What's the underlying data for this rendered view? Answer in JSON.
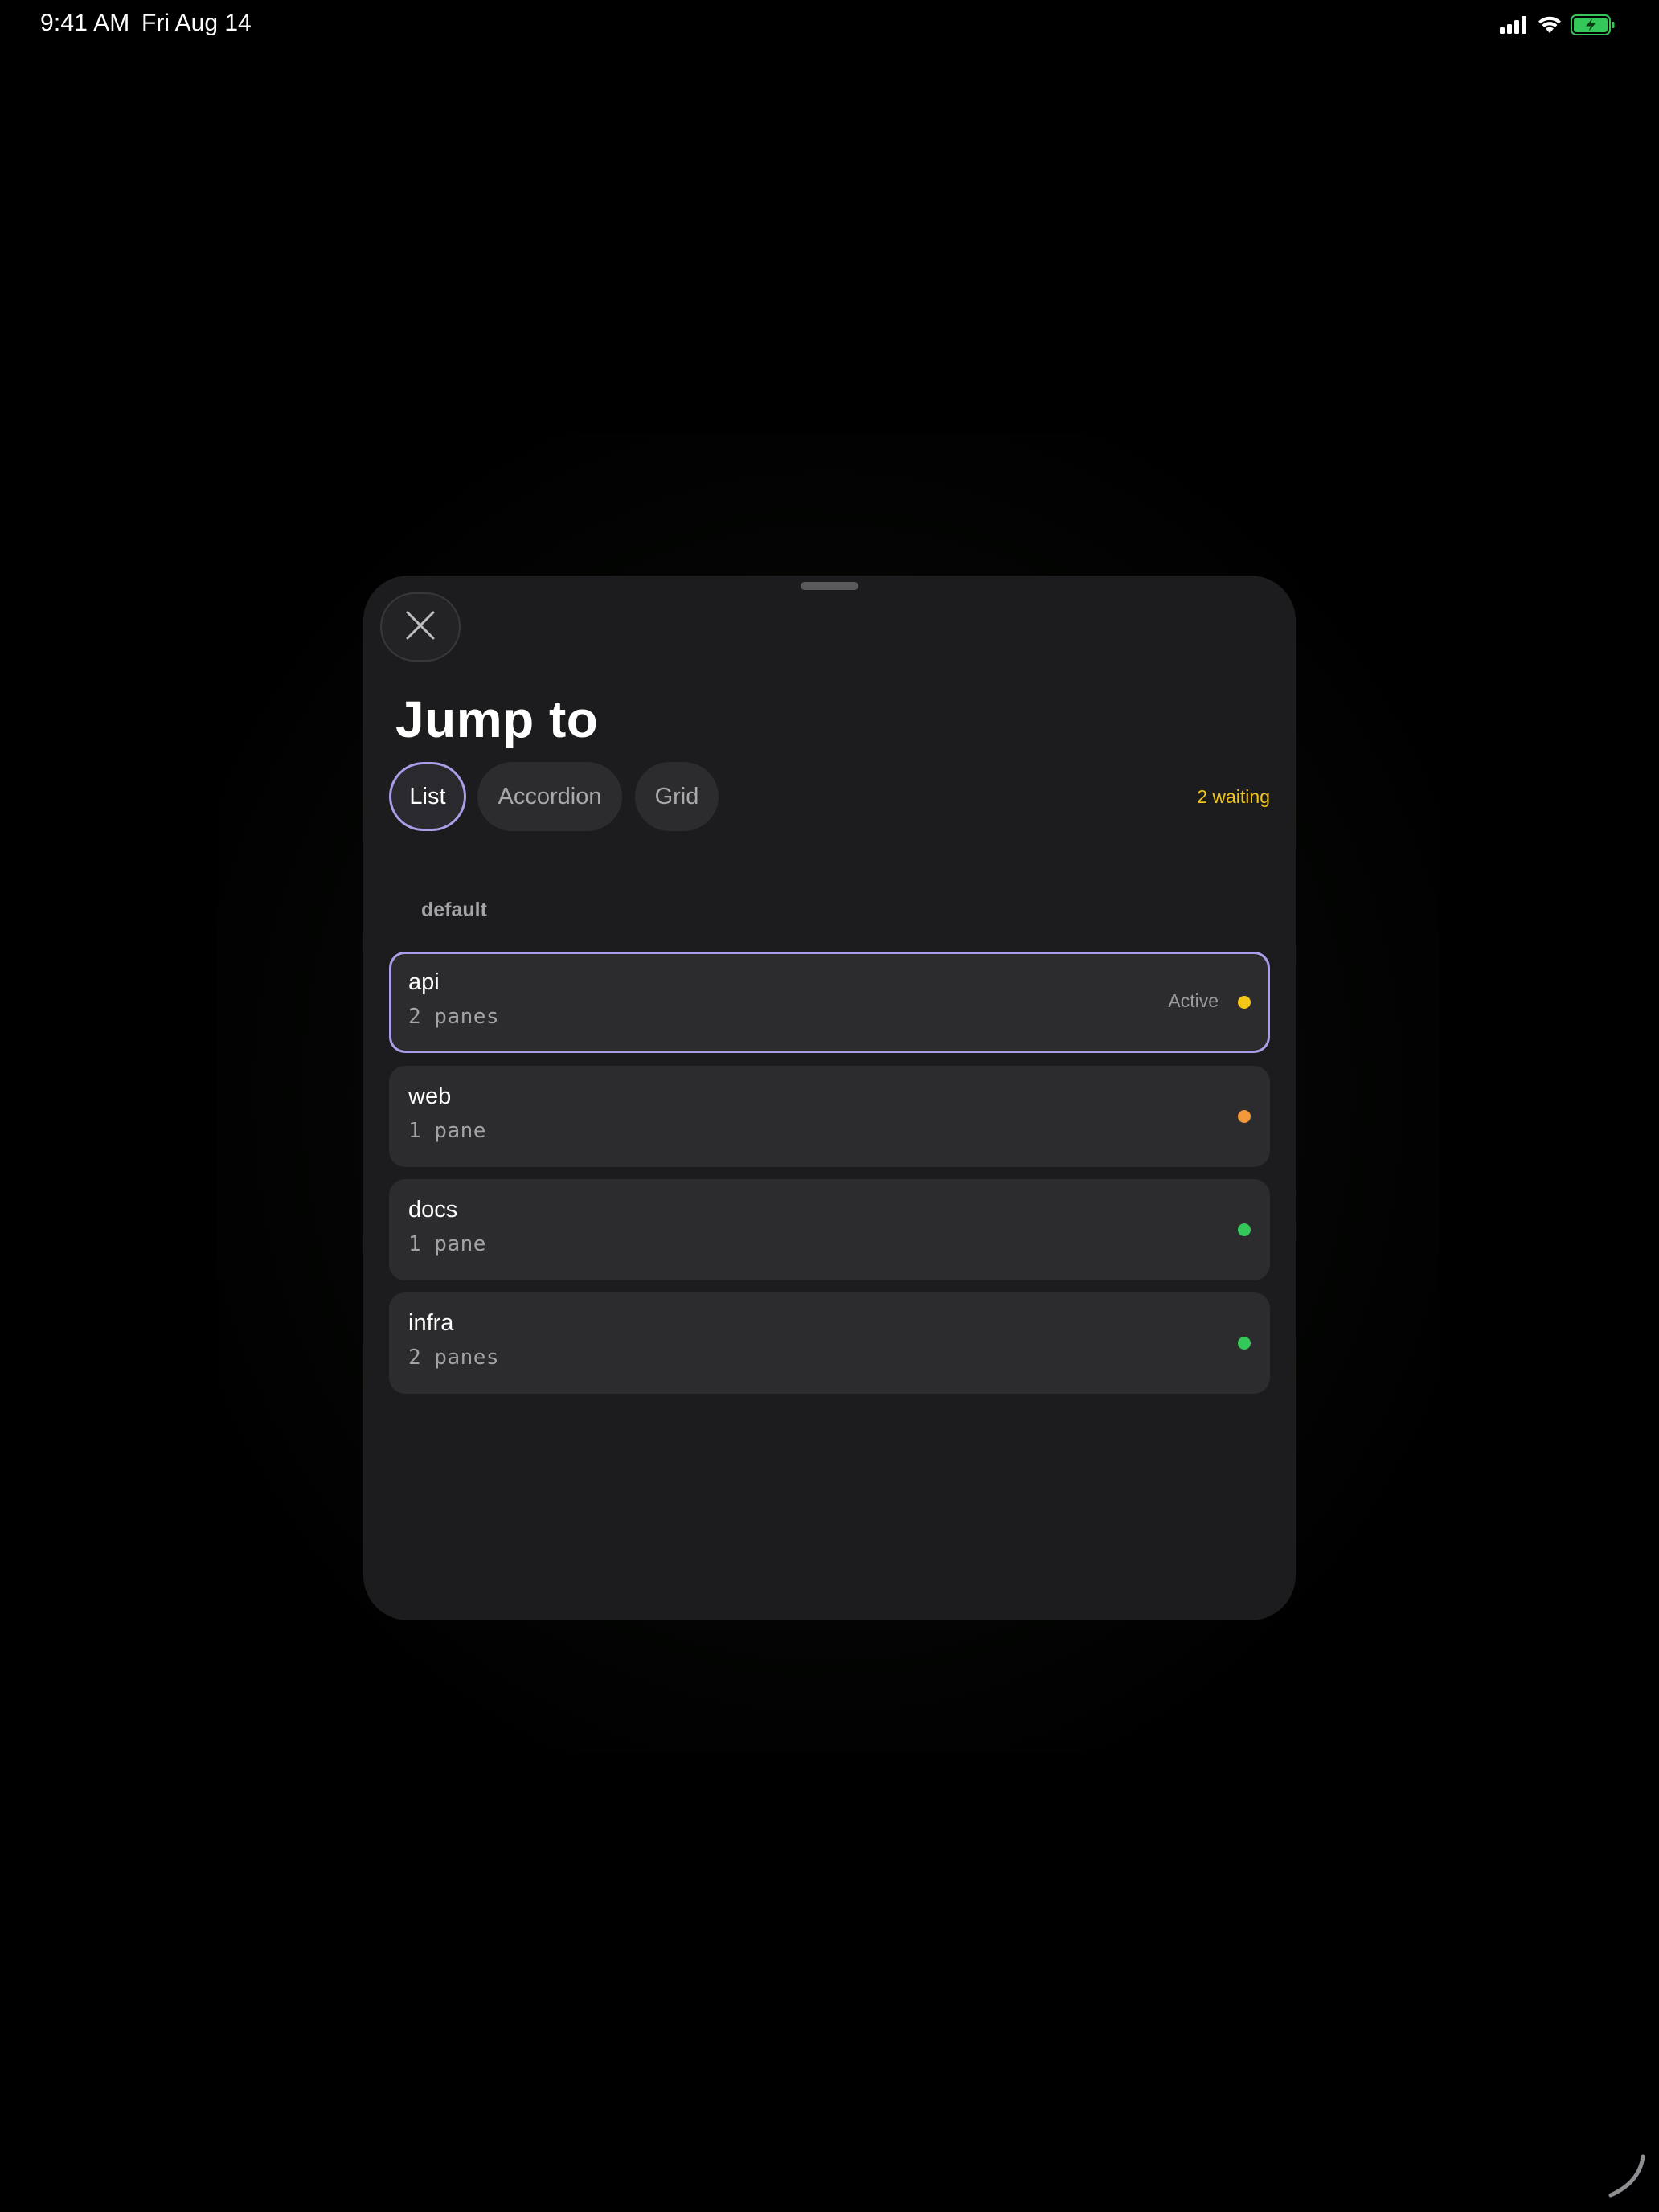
{
  "status_bar": {
    "time": "9:41 AM",
    "date": "Fri Aug 14",
    "icons": [
      "signal-icon",
      "wifi-icon",
      "battery-charging-icon"
    ]
  },
  "sheet": {
    "title": "Jump to",
    "close_icon": "close-icon",
    "view_modes": [
      {
        "label": "List",
        "selected": true
      },
      {
        "label": "Accordion",
        "selected": false
      },
      {
        "label": "Grid",
        "selected": false
      }
    ],
    "waiting_text": "2 waiting",
    "section": "default",
    "sessions": [
      {
        "name": "api",
        "panes": "2 panes",
        "badge": "Active",
        "status_color": "#f5c518",
        "active": true
      },
      {
        "name": "web",
        "panes": "1 pane",
        "badge": "",
        "status_color": "#f2973a",
        "active": false
      },
      {
        "name": "docs",
        "panes": "1 pane",
        "badge": "",
        "status_color": "#34c759",
        "active": false
      },
      {
        "name": "infra",
        "panes": "2 panes",
        "badge": "",
        "status_color": "#34c759",
        "active": false
      }
    ]
  },
  "colors": {
    "accent": "#a99ee8",
    "waiting": "#f2c51a",
    "sheet_bg": "#1c1c1e",
    "row_bg": "#2c2c2e"
  }
}
